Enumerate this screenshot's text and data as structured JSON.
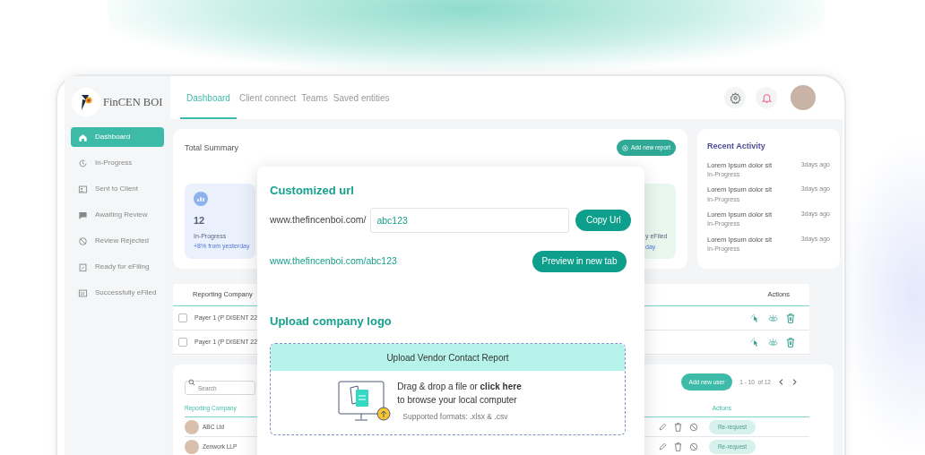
{
  "app": {
    "logo_text": "FinCEN BOI"
  },
  "sidebar": {
    "items": [
      {
        "label": "Dashboard",
        "selected": true
      },
      {
        "label": "In-Progress",
        "selected": false
      },
      {
        "label": "Sent to Client",
        "selected": false
      },
      {
        "label": "Awaiting Review",
        "selected": false
      },
      {
        "label": "Review Rejected",
        "selected": false
      },
      {
        "label": "Ready for eFiling",
        "selected": false
      },
      {
        "label": "Successfully eFiled",
        "selected": false
      }
    ]
  },
  "tabs": [
    {
      "label": "Dashboard",
      "selected": true
    },
    {
      "label": "Client connect",
      "selected": false
    },
    {
      "label": "Teams",
      "selected": false
    },
    {
      "label": "Saved entities",
      "selected": false
    }
  ],
  "summary": {
    "title": "Total Summary",
    "add_button": "Add new report",
    "cards": [
      {
        "kind": "full",
        "value": "12",
        "label": "In-Progress",
        "note": "+8% from yesterday"
      },
      {
        "kind": "partial",
        "label": "y eFiled",
        "note": "day"
      }
    ]
  },
  "recent_activity": {
    "title": "Recent Activity",
    "items": [
      {
        "title": "Lorem Ipsum dolor sit",
        "status": "In-Progress",
        "time": "3days ago"
      },
      {
        "title": "Lorem Ipsum dolor sit",
        "status": "In-Progress",
        "time": "3days ago"
      },
      {
        "title": "Lorem Ipsum dolor sit",
        "status": "In-Progress",
        "time": "3days ago"
      },
      {
        "title": "Lorem Ipsum dolor sit",
        "status": "In-Progress",
        "time": "3days ago"
      }
    ]
  },
  "reports_table": {
    "columns": [
      "Reporting Company",
      "Actions"
    ],
    "rows": [
      {
        "company": "Payer 1 (P DISENT 22",
        "checked": false
      },
      {
        "company": "Payer 1 (P DISENT 22",
        "checked": false
      }
    ]
  },
  "users_table": {
    "search_placeholder": "Search",
    "add_button": "Add new user",
    "pagination": "1 - 10  of 12",
    "columns": [
      "Reporting Company",
      "Actions"
    ],
    "rows": [
      {
        "company": "ABC Ltd",
        "action": "Re-request"
      },
      {
        "company": "Zenwork LLP",
        "action": "Re-request"
      }
    ]
  },
  "modal": {
    "url_title": "Customized url",
    "url_prefix": "www.thefincenboi.com/",
    "slug": "abc123",
    "copy_button": "Copy Url",
    "preview_url": "www.thefincenboi.com/abc123",
    "preview_button": "Preview in new tab",
    "logo_title": "Upload company logo",
    "upload": {
      "header": "Upload Vendor Contact Report",
      "instruction": "Drag & drop a file or **click here**",
      "instruction_2": "to browse your local computer",
      "formats": "Supported formats: .xlsx & .csv"
    }
  }
}
